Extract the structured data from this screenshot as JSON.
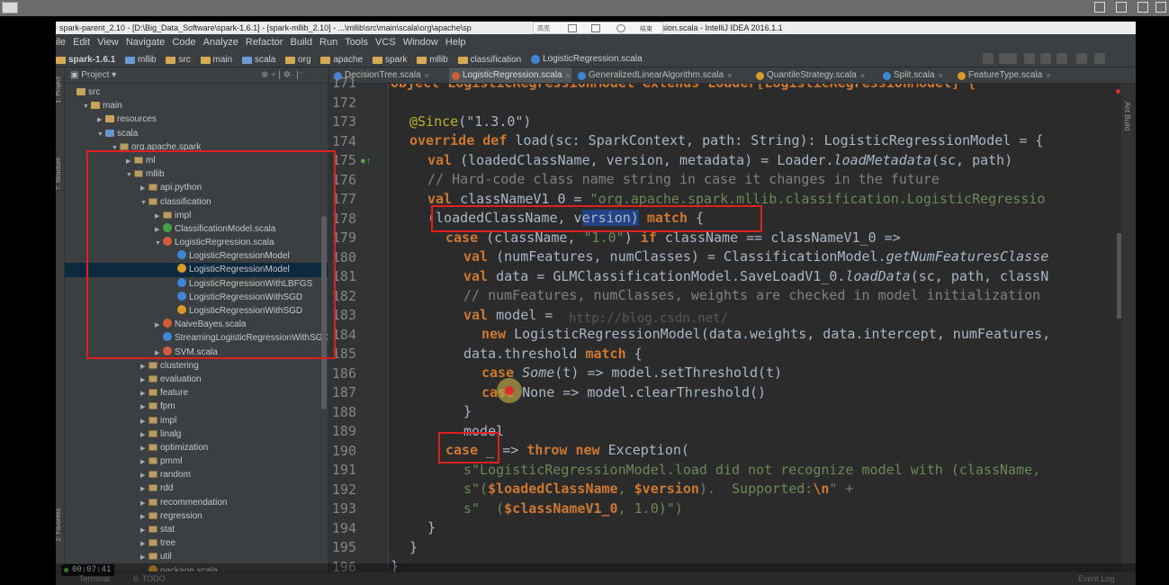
{
  "window": {
    "title_left": "spark-parent_2.10 - [D:\\Big_Data_Software\\spark-1.6.1] - [spark-mllib_2.10] - ...\\mllib\\src\\main\\scala\\org\\apache\\sp",
    "title_right": "gression.scala - IntelliJ IDEA 2016.1.1",
    "float_tools": {
      "a": "高亮",
      "b": "结束"
    }
  },
  "menu": [
    "ile",
    "Edit",
    "View",
    "Navigate",
    "Code",
    "Analyze",
    "Refactor",
    "Build",
    "Run",
    "Tools",
    "VCS",
    "Window",
    "Help"
  ],
  "breadcrumbs": [
    "spark-1.6.1",
    "mllib",
    "src",
    "main",
    "scala",
    "org",
    "apache",
    "spark",
    "mllib",
    "classification",
    "LogisticRegression.scala"
  ],
  "project_panel": {
    "header": "Project",
    "tools": "⊕ ÷ | ✲· |⁻",
    "tree": [
      {
        "label": "src",
        "depth": 0,
        "arrow": "",
        "icon": "folder"
      },
      {
        "label": "main",
        "depth": 1,
        "arrow": "▼",
        "icon": "folder"
      },
      {
        "label": "resources",
        "depth": 2,
        "arrow": "▶",
        "icon": "folder"
      },
      {
        "label": "scala",
        "depth": 2,
        "arrow": "▼",
        "icon": "folder-blue"
      },
      {
        "label": "org.apache.spark",
        "depth": 3,
        "arrow": "▼",
        "icon": "pkg"
      },
      {
        "label": "ml",
        "depth": 4,
        "arrow": "▶",
        "icon": "pkg"
      },
      {
        "label": "mllib",
        "depth": 4,
        "arrow": "▼",
        "icon": "pkg"
      },
      {
        "label": "api.python",
        "depth": 5,
        "arrow": "▶",
        "icon": "pkg"
      },
      {
        "label": "classification",
        "depth": 5,
        "arrow": "▼",
        "icon": "pkg"
      },
      {
        "label": "impl",
        "depth": 6,
        "arrow": "▶",
        "icon": "pkg"
      },
      {
        "label": "ClassificationModel.scala",
        "depth": 6,
        "arrow": "▶",
        "icon": "cls-t"
      },
      {
        "label": "LogisticRegression.scala",
        "depth": 6,
        "arrow": "▼",
        "icon": "scala"
      },
      {
        "label": "LogisticRegressionModel",
        "depth": 7,
        "arrow": "",
        "icon": "cls-c"
      },
      {
        "label": "LogisticRegressionModel",
        "depth": 7,
        "arrow": "",
        "icon": "cls-o",
        "selected": true
      },
      {
        "label": "LogisticRegressionWithLBFGS",
        "depth": 7,
        "arrow": "",
        "icon": "cls-c"
      },
      {
        "label": "LogisticRegressionWithSGD",
        "depth": 7,
        "arrow": "",
        "icon": "cls-c"
      },
      {
        "label": "LogisticRegressionWithSGD",
        "depth": 7,
        "arrow": "",
        "icon": "cls-o"
      },
      {
        "label": "NaiveBayes.scala",
        "depth": 6,
        "arrow": "▶",
        "icon": "scala"
      },
      {
        "label": "StreamingLogisticRegressionWithSGD",
        "depth": 6,
        "arrow": "",
        "icon": "cls-c"
      },
      {
        "label": "SVM.scala",
        "depth": 6,
        "arrow": "▶",
        "icon": "scala"
      },
      {
        "label": "clustering",
        "depth": 5,
        "arrow": "▶",
        "icon": "pkg"
      },
      {
        "label": "evaluation",
        "depth": 5,
        "arrow": "▶",
        "icon": "pkg"
      },
      {
        "label": "feature",
        "depth": 5,
        "arrow": "▶",
        "icon": "pkg"
      },
      {
        "label": "fpm",
        "depth": 5,
        "arrow": "▶",
        "icon": "pkg"
      },
      {
        "label": "impl",
        "depth": 5,
        "arrow": "▶",
        "icon": "pkg"
      },
      {
        "label": "linalg",
        "depth": 5,
        "arrow": "▶",
        "icon": "pkg"
      },
      {
        "label": "optimization",
        "depth": 5,
        "arrow": "▶",
        "icon": "pkg"
      },
      {
        "label": "pmml",
        "depth": 5,
        "arrow": "▶",
        "icon": "pkg"
      },
      {
        "label": "random",
        "depth": 5,
        "arrow": "▶",
        "icon": "pkg"
      },
      {
        "label": "rdd",
        "depth": 5,
        "arrow": "▶",
        "icon": "pkg"
      },
      {
        "label": "recommendation",
        "depth": 5,
        "arrow": "▶",
        "icon": "pkg"
      },
      {
        "label": "regression",
        "depth": 5,
        "arrow": "▶",
        "icon": "pkg"
      },
      {
        "label": "stat",
        "depth": 5,
        "arrow": "▶",
        "icon": "pkg"
      },
      {
        "label": "tree",
        "depth": 5,
        "arrow": "▶",
        "icon": "pkg"
      },
      {
        "label": "util",
        "depth": 5,
        "arrow": "▶",
        "icon": "pkg"
      },
      {
        "label": "package.scala",
        "depth": 5,
        "arrow": "",
        "icon": "cls-o"
      }
    ]
  },
  "tabs": [
    {
      "label": "DecisionTree.scala",
      "icon": "cls-c"
    },
    {
      "label": "LogisticRegression.scala",
      "icon": "scala",
      "active": true
    },
    {
      "label": "GeneralizedLinearAlgorithm.scala",
      "icon": "cls-c"
    },
    {
      "label": "QuantileStrategy.scala",
      "icon": "cls-o"
    },
    {
      "label": "Split.scala",
      "icon": "cls-c"
    },
    {
      "label": "FeatureType.scala",
      "icon": "cls-o"
    }
  ],
  "editor": {
    "line_numbers": [
      "171",
      "172",
      "173",
      "174",
      "175",
      "176",
      "177",
      "178",
      "179",
      "180",
      "181",
      "182",
      "183",
      "184",
      "185",
      "186",
      "187",
      "188",
      "189",
      "190",
      "191",
      "192",
      "193",
      "194",
      "195",
      "196"
    ],
    "watermark": "http://blog.csdn.net/",
    "lines": {
      "l171": "object LogisticRegressionModel extends Loader[LogisticRegressionModel] {",
      "l173_ann": "@Since",
      "l173_rest": "(\"1.3.0\")",
      "l174_kw": "override def",
      "l174_rest": " load(sc: SparkContext, path: String): LogisticRegressionModel = {",
      "l175_kw": "val",
      "l175_a": " (loadedClassName, version, metadata) = Loader.",
      "l175_fn": "loadMetadata",
      "l175_b": "(sc, path)",
      "l176": "// Hard-code class name string in case it changes in the future",
      "l177_kw": "val",
      "l177_a": " classNameV1_0 = ",
      "l177_str": "\"org.apache.spark.mllib.classification.LogisticRegressio",
      "l178_a": "(loadedClassName, v",
      "l178_sel": "ersion)",
      "l178_kw": " match",
      "l178_b": " {",
      "l179_kw": "case",
      "l179_a": " (className, ",
      "l179_str": "\"1.0\"",
      "l179_b": ") ",
      "l179_kw2": "if",
      "l179_c": " className == classNameV1_0 =>",
      "l180_kw": "val",
      "l180_a": " (numFeatures, numClasses) = ClassificationModel.",
      "l180_fn": "getNumFeaturesClasse",
      "l181_kw": "val",
      "l181_a": " data = GLMClassificationModel.SaveLoadV1_0.",
      "l181_fn": "loadData",
      "l181_b": "(sc, path, classN",
      "l182": "// numFeatures, numClasses, weights are checked in model initialization",
      "l183_kw": "val",
      "l183_a": " model =",
      "l184_kw": "new",
      "l184_a": " LogisticRegressionModel(data.weights, data.intercept, numFeatures,",
      "l185_a": "data.threshold ",
      "l185_kw": "match",
      "l185_b": " {",
      "l186_kw": "case",
      "l186_it": " Some",
      "l186_a": "(t) => model.setThreshold(t)",
      "l187_kw": "case",
      "l187_a": " None => model.clearThreshold()",
      "l188": "}",
      "l189": "model",
      "l190_kw": "case",
      "l190_a": " _ => ",
      "l190_kw2": "throw new",
      "l190_b": " Exception(",
      "l191_str": "s\"LogisticRegressionModel.load did not recognize model with (className,",
      "l192_a": "s\"(",
      "l192_v1": "$loadedClassName",
      "l192_b": ", ",
      "l192_v2": "$version",
      "l192_c": ").  Supported:",
      "l192_esc": "\\n",
      "l192_d": "\" +",
      "l193_a": "s\"  (",
      "l193_v": "$classNameV1_0",
      "l193_b": ", 1.0)\")",
      "l194": "}",
      "l195": "}",
      "l196": "}"
    }
  },
  "right_strip_label": "Ant Build",
  "tool_strip_labels": {
    "project": "1: Project",
    "structure": "7: Structure",
    "favorites": "2: Favorites"
  },
  "status": {
    "time": "00:07:41",
    "terminal": "Terminal",
    "todo": "6: TODO",
    "event_log": "Event Log"
  },
  "colors": {
    "keyword": "#cc7832",
    "string": "#6a8759",
    "comment": "#808080",
    "annotation": "#bbb529",
    "highlight_box": "#e02020",
    "selection": "#214283"
  }
}
